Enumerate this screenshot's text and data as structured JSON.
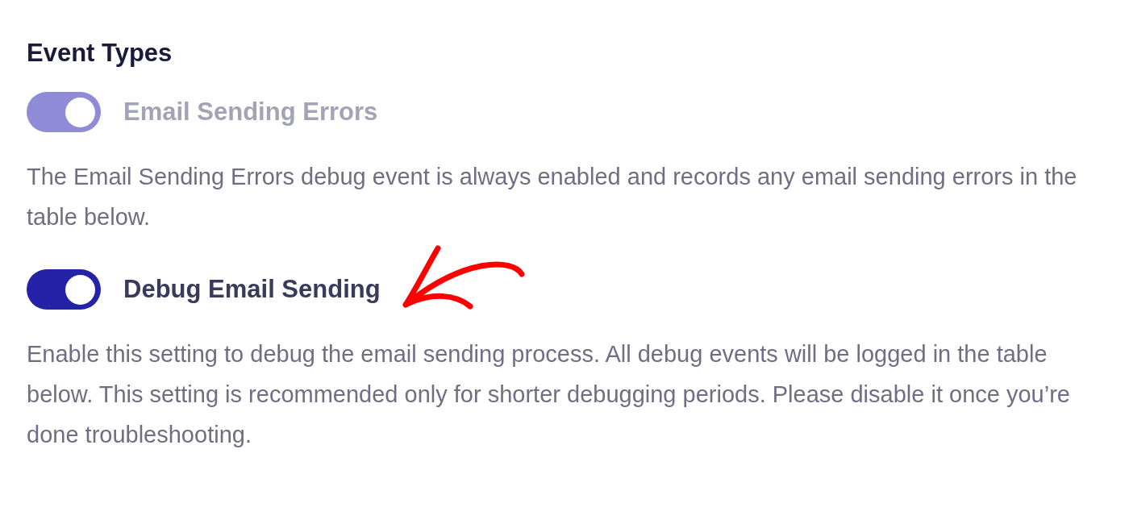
{
  "section": {
    "title": "Event Types"
  },
  "settings": [
    {
      "label": "Email Sending Errors",
      "on": true,
      "disabled": true,
      "description": "The Email Sending Errors debug event is always enabled and records any email sending errors in the table below."
    },
    {
      "label": "Debug Email Sending",
      "on": true,
      "disabled": false,
      "description": "Enable this setting to debug the email sending process. All debug events will be logged in the table below. This setting is recommended only for shorter debugging periods. Please disable it once you’re done troubleshooting."
    }
  ]
}
